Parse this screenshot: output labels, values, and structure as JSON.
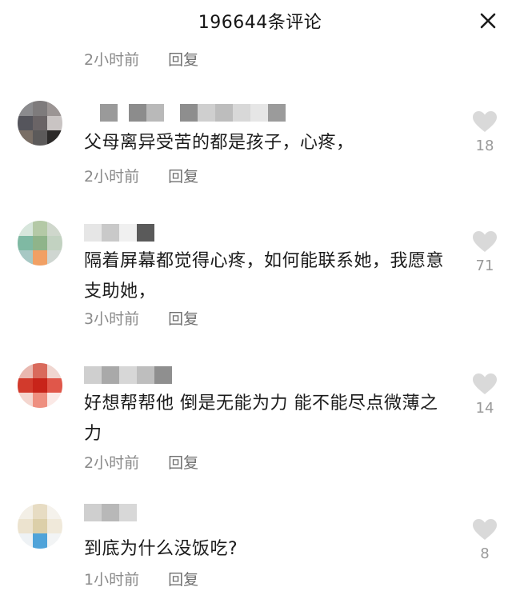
{
  "header": {
    "title": "196644条评论",
    "close_icon": "close-icon"
  },
  "top_meta": {
    "time": "2小时前",
    "reply": "回复"
  },
  "comments": [
    {
      "text": "父母离异受苦的都是孩子，心疼，",
      "time": "2小时前",
      "reply": "回复",
      "likes": "18",
      "avatar_icon": "avatar",
      "like_icon": "heart-icon"
    },
    {
      "text": "隔着屏幕都觉得心疼，如何能联系她，我愿意支助她，",
      "time": "3小时前",
      "reply": "回复",
      "likes": "71",
      "avatar_icon": "avatar",
      "like_icon": "heart-icon"
    },
    {
      "text": "好想帮帮他 倒是无能为力 能不能尽点微薄之力",
      "time": "2小时前",
      "reply": "回复",
      "likes": "14",
      "avatar_icon": "avatar",
      "like_icon": "heart-icon"
    },
    {
      "text": "到底为什么没饭吃?",
      "time": "1小时前",
      "reply": "回复",
      "likes": "8",
      "avatar_icon": "avatar",
      "like_icon": "heart-icon"
    }
  ],
  "colors": {
    "text": "#1b1b1b",
    "meta": "#8a8a8a",
    "like": "#d9d9d9",
    "count": "#9a9a9a"
  }
}
